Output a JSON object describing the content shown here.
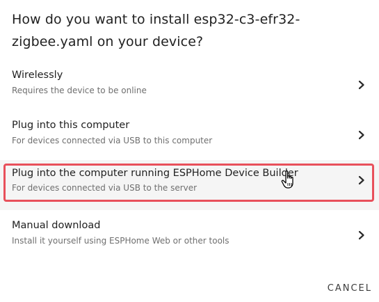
{
  "dialog": {
    "title": "How do you want to install esp32-c3-efr32-zigbee.yaml on your device?",
    "options": [
      {
        "label": "Wirelessly",
        "description": "Requires the device to be online",
        "icon": "chevron-right-icon"
      },
      {
        "label": "Plug into this computer",
        "description": "For devices connected via USB to this computer",
        "icon": "chevron-right-icon"
      },
      {
        "label": "Plug into the computer running ESPHome Device Builder",
        "description": "For devices connected via USB to the server",
        "icon": "chevron-right-icon",
        "highlighted": true
      },
      {
        "label": "Manual download",
        "description": "Install it yourself using ESPHome Web or other tools",
        "icon": "chevron-right-icon"
      }
    ],
    "cancel_label": "CANCEL",
    "highlight_color": "#e8505b"
  }
}
